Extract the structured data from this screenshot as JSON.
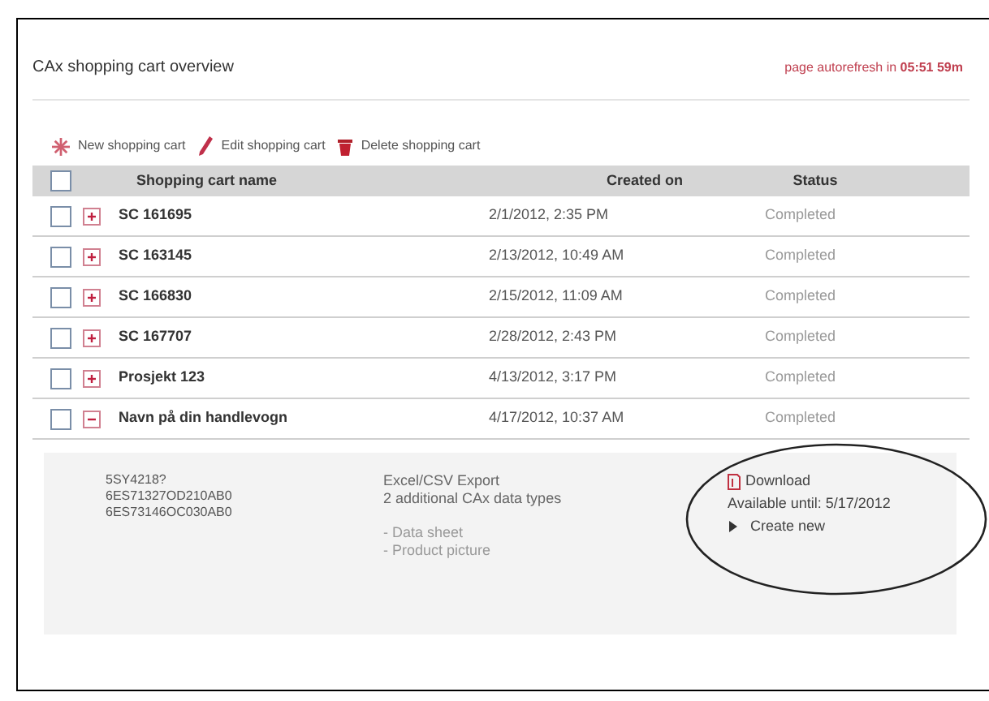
{
  "title": "CAx shopping cart overview",
  "autorefresh": {
    "label": "page autorefresh in",
    "time": "05:51 59m"
  },
  "toolbar": [
    {
      "kind": "new",
      "label": "New shopping cart"
    },
    {
      "kind": "edit",
      "label": "Edit shopping cart"
    },
    {
      "kind": "delete",
      "label": "Delete shopping cart"
    }
  ],
  "table": {
    "header_checked": false,
    "columns": [
      "Shopping cart name",
      "Created on",
      "Status"
    ],
    "rows": [
      {
        "checked": false,
        "expanded": false,
        "name": "SC 161695",
        "created": "2/1/2012, 2:35 PM",
        "status": "Completed"
      },
      {
        "checked": false,
        "expanded": false,
        "name": "SC 163145",
        "created": "2/13/2012, 10:49 AM",
        "status": "Completed"
      },
      {
        "checked": false,
        "expanded": false,
        "name": "SC 166830",
        "created": "2/15/2012, 11:09 AM",
        "status": "Completed"
      },
      {
        "checked": false,
        "expanded": false,
        "name": "SC 167707",
        "created": "2/28/2012, 2:43 PM",
        "status": "Completed"
      },
      {
        "checked": false,
        "expanded": false,
        "name": "Prosjekt 123",
        "created": "4/13/2012, 3:17 PM",
        "status": "Completed"
      },
      {
        "checked": false,
        "expanded": true,
        "name": "Navn på din handlevogn",
        "created": "4/17/2012, 10:37 AM",
        "status": "Completed"
      }
    ]
  },
  "details": {
    "codes": [
      "5SY4218?",
      "6ES71327OD210AB0",
      "6ES73146OC030AB0"
    ],
    "export_title": "Excel/CSV Export",
    "export_subtitle": "2 additional CAx data types",
    "export_items": [
      "- Data sheet",
      "- Product picture"
    ],
    "download": "Download",
    "available": "Available until: 5/17/2012",
    "create_new": "Create new"
  }
}
